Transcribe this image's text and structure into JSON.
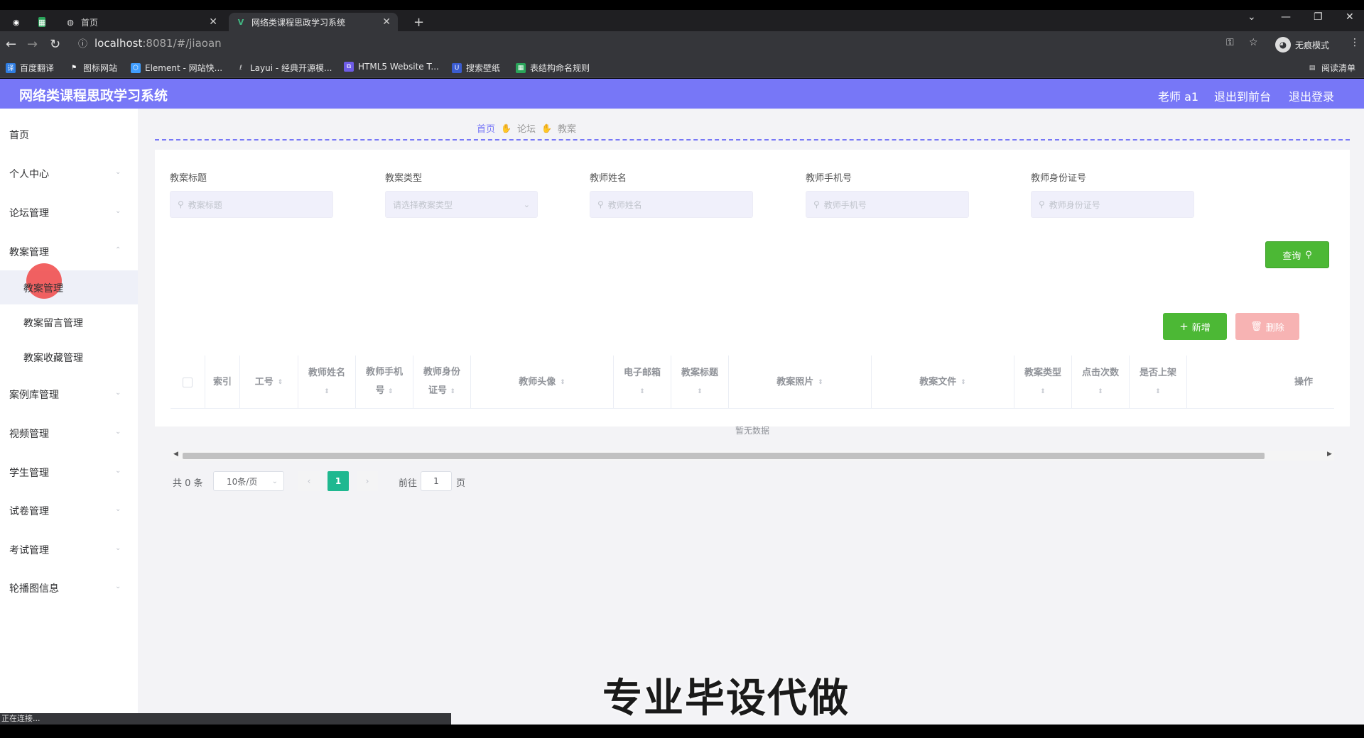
{
  "browser": {
    "tabs": [
      {
        "label": "首页"
      },
      {
        "label": "网络类课程思政学习系统"
      }
    ],
    "url_host": "localhost",
    "url_path": ":8081/#/jiaoan",
    "incognito_label": "无痕模式",
    "reading_list": "阅读清单",
    "bookmarks": [
      "百度翻译",
      "图标网站",
      "Element - 网站快...",
      "Layui - 经典开源模...",
      "HTML5 Website T...",
      "搜索壁纸",
      "表结构命名规则"
    ],
    "status_text": "正在连接..."
  },
  "header": {
    "title": "网络类课程思政学习系统",
    "user": "老师 a1",
    "exit_front": "退出到前台",
    "logout": "退出登录"
  },
  "sidebar": {
    "items": [
      {
        "label": "首页"
      },
      {
        "label": "个人中心"
      },
      {
        "label": "论坛管理"
      },
      {
        "label": "教案管理"
      },
      {
        "label": "案例库管理"
      },
      {
        "label": "视频管理"
      },
      {
        "label": "学生管理"
      },
      {
        "label": "试卷管理"
      },
      {
        "label": "考试管理"
      },
      {
        "label": "轮播图信息"
      }
    ],
    "sub_items": [
      {
        "label": "教案管理"
      },
      {
        "label": "教案留言管理"
      },
      {
        "label": "教案收藏管理"
      }
    ]
  },
  "breadcrumb": [
    "首页",
    "论坛",
    "教案"
  ],
  "filters": [
    {
      "label": "教案标题",
      "placeholder": "教案标题"
    },
    {
      "label": "教案类型",
      "placeholder": "请选择教案类型"
    },
    {
      "label": "教师姓名",
      "placeholder": "教师姓名"
    },
    {
      "label": "教师手机号",
      "placeholder": "教师手机号"
    },
    {
      "label": "教师身份证号",
      "placeholder": "教师身份证号"
    }
  ],
  "buttons": {
    "query": "查询",
    "add": "新增",
    "delete": "删除"
  },
  "table": {
    "columns": [
      "索引",
      "工号",
      "教师姓名",
      "教师手机号",
      "教师身份证号",
      "教师头像",
      "电子邮箱",
      "教案标题",
      "教案照片",
      "教案文件",
      "教案类型",
      "点击次数",
      "是否上架",
      "操作"
    ],
    "col_lines": {
      "c2": [
        "教师姓名",
        ""
      ],
      "c3": [
        "教师手机",
        "号"
      ],
      "c4": [
        "教师身份",
        "证号"
      ],
      "c6": [
        "电子邮箱",
        ""
      ],
      "c7": [
        "教案标题",
        ""
      ],
      "c10": [
        "教案类型",
        ""
      ],
      "c11": [
        "点击次数",
        ""
      ],
      "c12": [
        "是否上架",
        ""
      ]
    },
    "empty_text": "暂无数据"
  },
  "pagination": {
    "total": "共 0 条",
    "page_size": "10条/页",
    "current": "1",
    "goto_prefix": "前往",
    "goto_value": "1",
    "goto_suffix": "页"
  },
  "watermark": "专业毕设代做",
  "colors": {
    "accent": "#7777f7",
    "success": "#4cb835",
    "danger_light": "#f7b3b3",
    "page_current": "#1fb890"
  }
}
